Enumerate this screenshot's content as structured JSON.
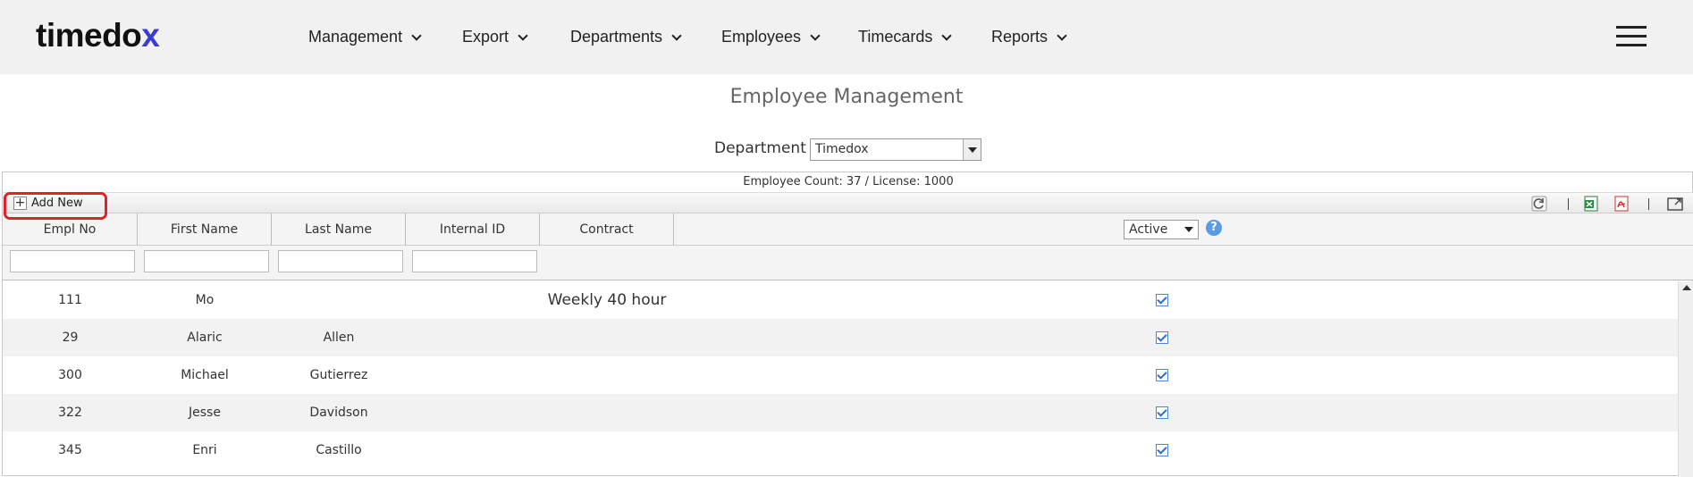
{
  "brand": {
    "name_main": "timedo",
    "name_accent": "x",
    "accent_color": "#3b3bd8"
  },
  "nav": {
    "items": [
      {
        "label": "Management"
      },
      {
        "label": "Export"
      },
      {
        "label": "Departments"
      },
      {
        "label": "Employees"
      },
      {
        "label": "Timecards"
      },
      {
        "label": "Reports"
      }
    ]
  },
  "page": {
    "title": "Employee Management"
  },
  "department": {
    "label": "Department",
    "value": "Timedox"
  },
  "grid": {
    "count_text": "Employee Count: 37 / License: 1000",
    "add_new_label": "Add New",
    "columns": [
      "Empl No",
      "First Name",
      "Last Name",
      "Internal ID",
      "Contract"
    ],
    "status_filter": "Active",
    "help_label": "?",
    "rows": [
      {
        "empl_no": "111",
        "first": "Mo",
        "last": "",
        "internal_id": "",
        "contract": "Weekly 40 hour",
        "active": true
      },
      {
        "empl_no": "29",
        "first": "Alaric",
        "last": "Allen",
        "internal_id": "",
        "contract": "",
        "active": true
      },
      {
        "empl_no": "300",
        "first": "Michael",
        "last": "Gutierrez",
        "internal_id": "",
        "contract": "",
        "active": true
      },
      {
        "empl_no": "322",
        "first": "Jesse",
        "last": "Davidson",
        "internal_id": "",
        "contract": "",
        "active": true
      },
      {
        "empl_no": "345",
        "first": "Enri",
        "last": "Castillo",
        "internal_id": "",
        "contract": "",
        "active": true
      }
    ]
  },
  "icons": [
    "plus-icon",
    "refresh-icon",
    "excel-export-icon",
    "pdf-export-icon",
    "maximize-icon",
    "hamburger-icon",
    "help-icon"
  ],
  "colors": {
    "highlight": "#e0222a",
    "checkbox": "#2f6dc4"
  }
}
